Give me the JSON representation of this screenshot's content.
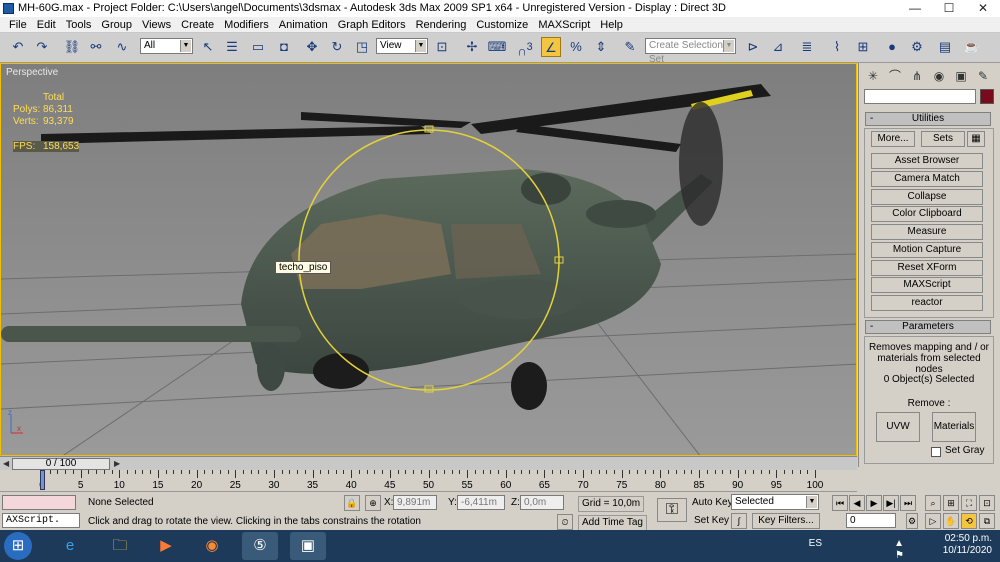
{
  "titlebar": {
    "text": "MH-60G.max     - Project Folder: C:\\Users\\angel\\Documents\\3dsmax     - Autodesk 3ds Max  2009 SP1  x64    - Unregistered Version     - Display : Direct 3D",
    "minimize": "—",
    "maximize": "☐",
    "close": "✕"
  },
  "menubar": {
    "items": [
      "File",
      "Edit",
      "Tools",
      "Group",
      "Views",
      "Create",
      "Modifiers",
      "Animation",
      "Graph Editors",
      "Rendering",
      "Customize",
      "MAXScript",
      "Help"
    ]
  },
  "toolbar": {
    "selection_filter": "All",
    "ref_coord": "View",
    "named_selection_placeholder": "Create Selection Set",
    "snap_label": "3"
  },
  "viewport": {
    "label": "Perspective",
    "stats_header": "Total",
    "polys_label": "Polys:",
    "polys_value": "86,311",
    "verts_label": "Verts:",
    "verts_value": "93,379",
    "fps_label": "FPS:",
    "fps_value": "158,653",
    "object_label": "techo_piso",
    "axis_z": "z",
    "axis_x": "x"
  },
  "command_panel": {
    "utilities_title": "Utilities",
    "more_button": "More...",
    "sets_button": "Sets",
    "utilities": [
      "Asset Browser",
      "Camera Match",
      "Collapse",
      "Color Clipboard",
      "Measure",
      "Motion Capture",
      "Reset XForm",
      "MAXScript",
      "reactor"
    ],
    "parameters_title": "Parameters",
    "description": "Removes mapping and / or materials from selected nodes",
    "selected_count": "0 Object(s) Selected",
    "remove_label": "Remove :",
    "uvw_button": "UVW",
    "materials_button": "Materials",
    "set_gray_label": "Set Gray",
    "swatch_color": "#7a0b1c"
  },
  "timeline": {
    "frame_display": "0 / 100",
    "tick_labels": [
      "0",
      "5",
      "10",
      "15",
      "20",
      "25",
      "30",
      "35",
      "40",
      "45",
      "50",
      "55",
      "60",
      "65",
      "70",
      "75",
      "80",
      "85",
      "90",
      "95",
      "100"
    ]
  },
  "statusbar": {
    "selection_status": "None Selected",
    "prompt": "Click and drag to rotate the view.  Clicking in the tabs constrains the rotation",
    "maxscript_listener": "AXScript.",
    "x_label": "X:",
    "x_value": "9,891m",
    "y_label": "Y:",
    "y_value": "-6,411m",
    "z_label": "Z:",
    "z_value": "0,0m",
    "grid": "Grid = 10,0m",
    "add_time_tag": "Add Time Tag",
    "auto_key": "Auto Key",
    "set_key": "Set Key",
    "key_mode": "Selected",
    "key_filters": "Key Filters...",
    "current_frame": "0"
  },
  "taskbar": {
    "language": "ES",
    "time": "02:50 p.m.",
    "date": "10/11/2020"
  }
}
